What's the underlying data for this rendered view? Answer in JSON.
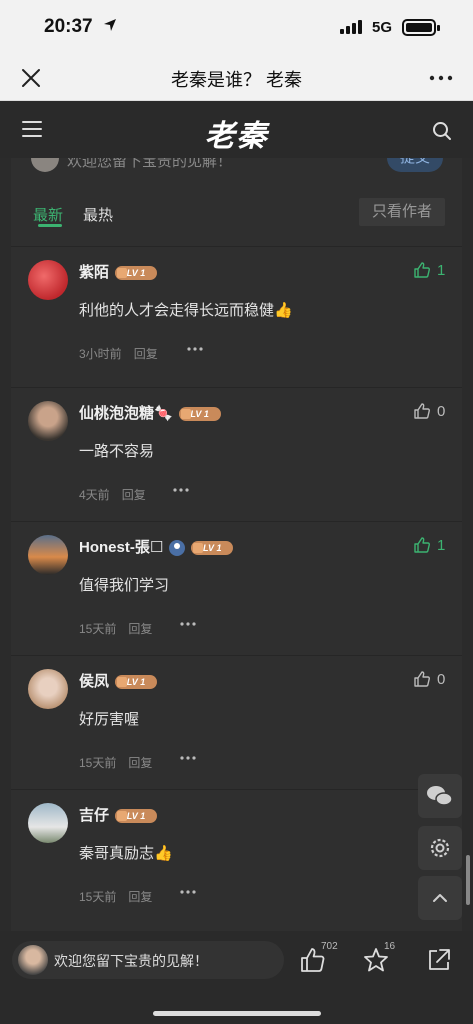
{
  "status_bar": {
    "time": "20:37",
    "network": "5G"
  },
  "title_bar": {
    "title": "老秦是谁？ 老秦"
  },
  "header": {
    "logo": "老秦"
  },
  "comment_box_peek": {
    "placeholder": "欢迎您留下宝贵的见解！",
    "submit_label": "提交"
  },
  "tabs": {
    "latest": "最新",
    "hot": "最热",
    "author_only": "只看作者"
  },
  "comments": [
    {
      "name": "紫陌",
      "badge": "LV 1",
      "text": "利他的人才会走得长远而稳健👍",
      "likes": "1",
      "liked": true,
      "time": "3小时前",
      "reply": "回复"
    },
    {
      "name": "仙桃泡泡糖🍬",
      "badge": "LV 1",
      "text": "一路不容易",
      "likes": "0",
      "liked": false,
      "time": "4天前",
      "reply": "回复"
    },
    {
      "name": "Honest-張☐",
      "badge": "LV 1",
      "text": "值得我们学习",
      "likes": "1",
      "liked": true,
      "time": "15天前",
      "reply": "回复"
    },
    {
      "name": "侯凤",
      "badge": "LV 1",
      "text": "好厉害喔",
      "likes": "0",
      "liked": false,
      "time": "15天前",
      "reply": "回复"
    },
    {
      "name": "吉仔",
      "badge": "LV 1",
      "text": "秦哥真励志👍",
      "likes": "",
      "liked": false,
      "time": "15天前",
      "reply": "回复"
    }
  ],
  "bottom_bar": {
    "placeholder": "欢迎您留下宝贵的见解！",
    "like_count": "702",
    "star_count": "16"
  },
  "colors": {
    "accent_green": "#3cb371",
    "background": "#2b2b2b",
    "badge": "#c98a5a"
  }
}
